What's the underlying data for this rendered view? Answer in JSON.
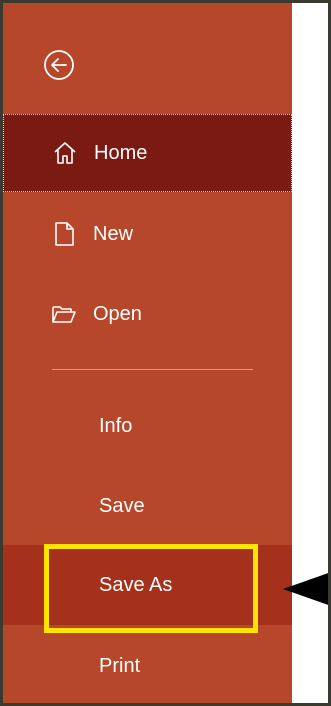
{
  "sidebar": {
    "back_icon": "back-arrow-icon",
    "items": [
      {
        "id": "home",
        "label": "Home",
        "icon": "home-icon",
        "state": "selected"
      },
      {
        "id": "new",
        "label": "New",
        "icon": "new-document-icon"
      },
      {
        "id": "open",
        "label": "Open",
        "icon": "open-folder-icon"
      },
      {
        "id": "info",
        "label": "Info"
      },
      {
        "id": "save",
        "label": "Save"
      },
      {
        "id": "save_as",
        "label": "Save As",
        "state": "hover"
      },
      {
        "id": "print",
        "label": "Print"
      }
    ]
  },
  "colors": {
    "sidebar_background": "#b7472a",
    "selected_background": "#7b1a12",
    "hover_background": "#a5301c",
    "highlight_border": "#ffe400",
    "text": "#ffffff"
  },
  "annotation": {
    "highlight_target": "save_as",
    "arrow": "pointer-arrow-left"
  }
}
